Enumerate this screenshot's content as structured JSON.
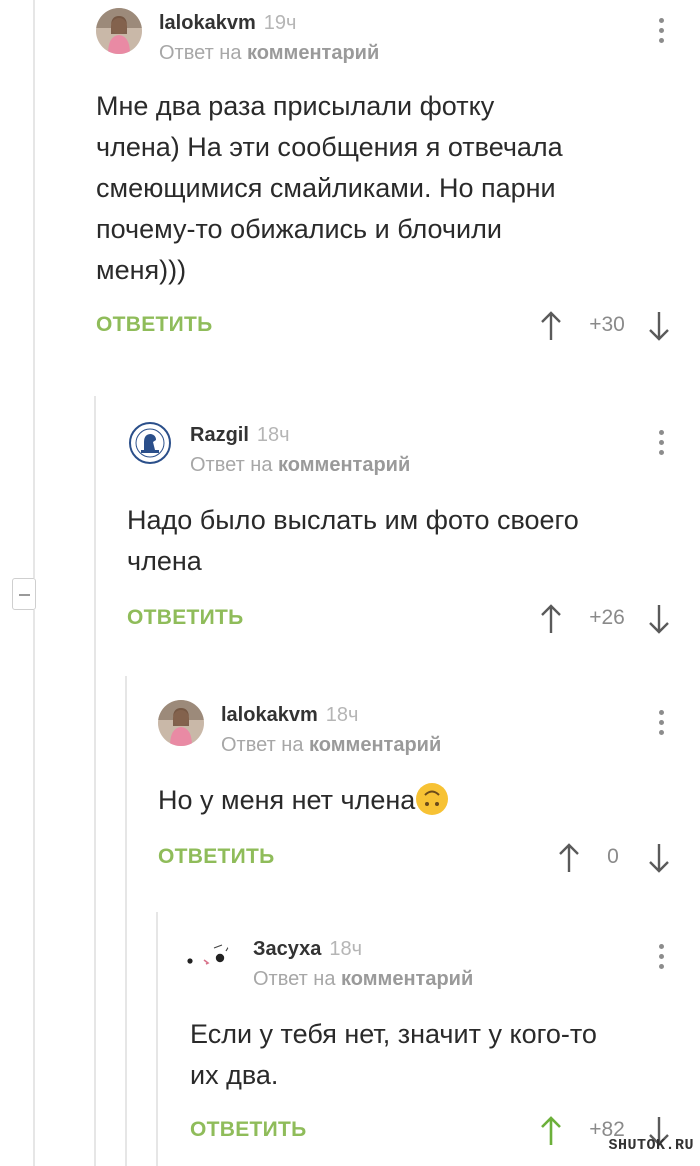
{
  "comments": [
    {
      "author": "lalokakvm",
      "time": "19ч",
      "reply_to_prefix": "Ответ на",
      "reply_to_target": "комментарий",
      "text": "Мне два раза присылали фотку\nчлена) На эти сообщения я отвечала\nсмеющимися смайликами. Но парни\nпочему-то обижались и блочили\nменя)))",
      "reply_label": "ОТВЕТИТЬ",
      "score": "+30"
    },
    {
      "author": "Razgil",
      "time": "18ч",
      "reply_to_prefix": "Ответ на",
      "reply_to_target": "комментарий",
      "text": "Надо было выслать им фото своего\nчлена",
      "reply_label": "ОТВЕТИТЬ",
      "score": "+26"
    },
    {
      "author": "lalokakvm",
      "time": "18ч",
      "reply_to_prefix": "Ответ на",
      "reply_to_target": "комментарий",
      "text": "Но у меня нет члена",
      "reply_label": "ОТВЕТИТЬ",
      "score": "0"
    },
    {
      "author": "Засуха",
      "time": "18ч",
      "reply_to_prefix": "Ответ на",
      "reply_to_target": "комментарий",
      "text": "Если у тебя нет, значит у кого-то\nих два.",
      "reply_label": "ОТВЕТИТЬ",
      "score": "+82"
    }
  ],
  "watermark": "SHUTOK.RU",
  "colors": {
    "accent_green": "#8fbc5a",
    "upvoted_green": "#6cb03a",
    "muted_text": "#a7a7a7",
    "thread_line": "#e6e6e6"
  }
}
